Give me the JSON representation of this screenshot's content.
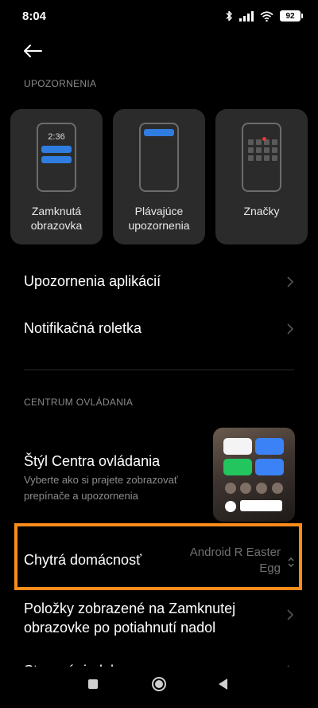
{
  "status": {
    "time": "8:04",
    "battery": "92",
    "icons": [
      "bluetooth-icon",
      "signal-icon",
      "wifi-icon",
      "battery-icon"
    ]
  },
  "header": {
    "back_icon": "back-arrow-icon"
  },
  "notifications": {
    "section_title": "UPOZORNENIA",
    "cards": [
      {
        "label": "Zamknutá\nobrazovka",
        "preview_time": "2:36",
        "icon": "lock-screen-preview"
      },
      {
        "label": "Plávajúce\nupozornenia",
        "icon": "floating-notification-preview"
      },
      {
        "label": "Značky",
        "icon": "badge-preview"
      }
    ],
    "rows": [
      {
        "title": "Upozornenia aplikácií"
      },
      {
        "title": "Notifikačná roletka"
      }
    ]
  },
  "control_center": {
    "section_title": "CENTRUM OVLÁDANIA",
    "style_title": "Štýl Centra ovládania",
    "style_subtitle": "Vyberte ako si prajete zobrazovať prepínače a upozornenia",
    "smart_home_title": "Chytrá domácnosť",
    "smart_home_value": "Android R Easter Egg",
    "lockscreen_items_title": "Položky zobrazené na Zamknutej obrazovke po potiahnutí nadol",
    "partial_row_title": "Stavový riadok"
  },
  "colors": {
    "background": "#000000",
    "card": "#2b2b2b",
    "accent_blue": "#2f7de1",
    "highlight_orange": "#ff8c1a",
    "secondary_text": "#8a8a8a"
  }
}
